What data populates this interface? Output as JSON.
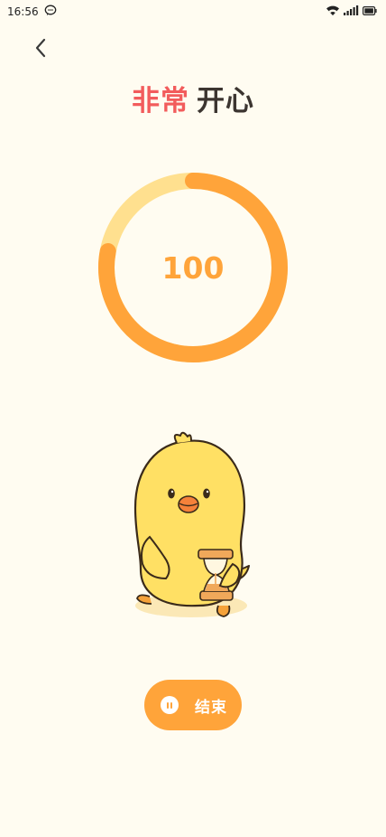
{
  "status_bar": {
    "time": "16:56",
    "icons": [
      "chat-bubble-icon",
      "wifi-icon",
      "signal-icon",
      "battery-icon"
    ]
  },
  "navigation": {
    "back_icon": "chevron-left-icon"
  },
  "mood": {
    "prefix": "非常",
    "word": "开心",
    "prefix_color": "#f25c5c",
    "word_color": "#3c3530"
  },
  "ring": {
    "value": "100",
    "progress": 0.78,
    "track_color": "#ffe08f",
    "progress_color": "#ffa43a"
  },
  "illustration": {
    "name": "chick-with-hourglass"
  },
  "end_button": {
    "label": "结束",
    "icon": "pause-icon",
    "color": "#ffa43a"
  },
  "colors": {
    "background": "#fffcf1",
    "accent": "#ffa43a"
  }
}
